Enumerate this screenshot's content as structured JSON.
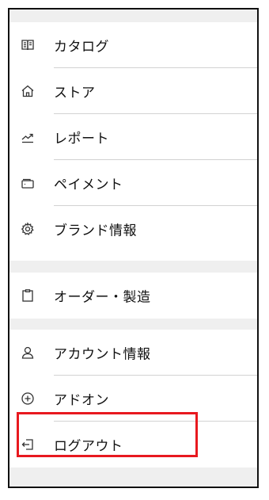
{
  "menu": {
    "group1": [
      {
        "label": "カタログ",
        "icon": "book-icon"
      },
      {
        "label": "ストア",
        "icon": "home-icon"
      },
      {
        "label": "レポート",
        "icon": "trend-icon"
      },
      {
        "label": "ペイメント",
        "icon": "wallet-icon"
      },
      {
        "label": "ブランド情報",
        "icon": "gear-icon"
      }
    ],
    "group2": [
      {
        "label": "オーダー・製造",
        "icon": "clipboard-icon"
      }
    ],
    "group3": [
      {
        "label": "アカウント情報",
        "icon": "user-icon"
      },
      {
        "label": "アドオン",
        "icon": "plus-circle-icon"
      },
      {
        "label": "ログアウト",
        "icon": "logout-icon"
      }
    ]
  },
  "colors": {
    "highlight": "#e8191f",
    "background": "#efefef",
    "divider": "#d2d2d2"
  }
}
